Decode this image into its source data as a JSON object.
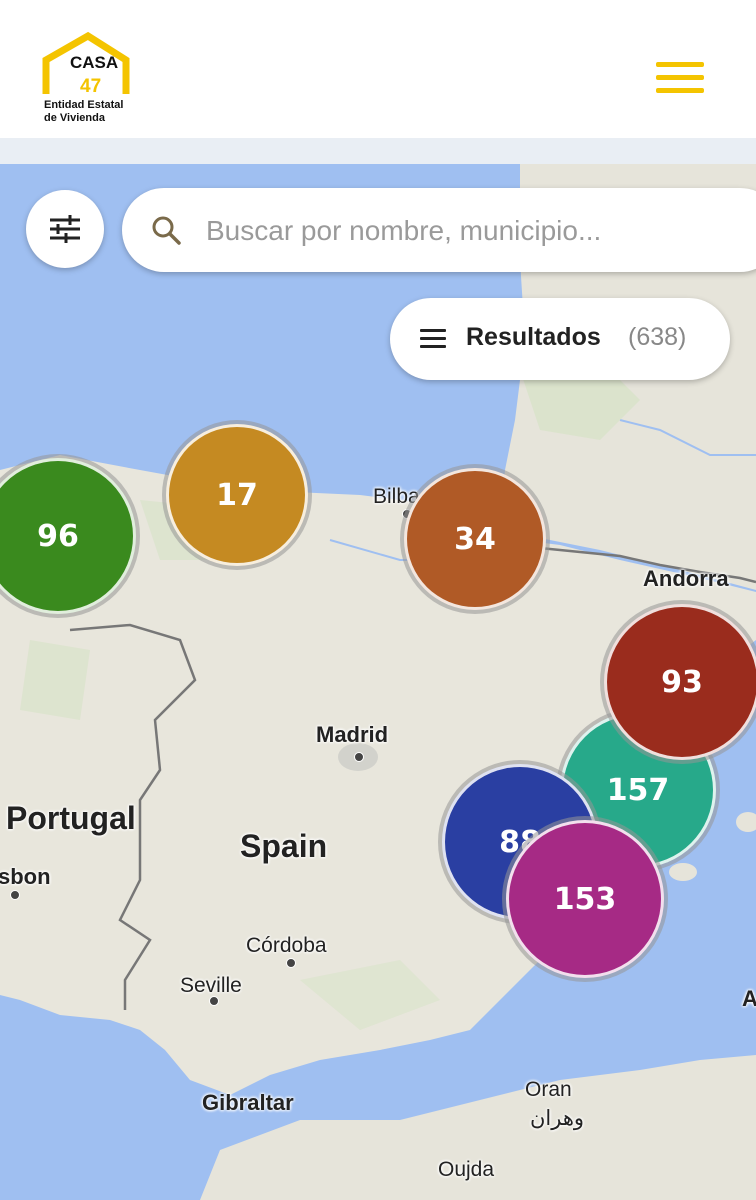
{
  "header": {
    "logo_text": "CASA",
    "logo_number": "47",
    "logo_line1": "Entidad Estatal",
    "logo_line2": "de Vivienda"
  },
  "search": {
    "placeholder": "Buscar por nombre, municipio..."
  },
  "results": {
    "label": "Resultados",
    "count": "(638)"
  },
  "places": {
    "portugal": "Portugal",
    "spain": "Spain",
    "madrid": "Madrid",
    "andorra": "Andorra",
    "bilbao": "Bilba",
    "lisbon": "sbon",
    "cordoba": "Córdoba",
    "seville": "Seville",
    "gibraltar": "Gibraltar",
    "oran": "Oran",
    "oran_ar": "وهران",
    "oujda": "Oujda",
    "edge_a": "A"
  },
  "clusters": [
    {
      "id": "c96",
      "label": "96",
      "color": "#3a8a1e"
    },
    {
      "id": "c17",
      "label": "17",
      "color": "#c58a22"
    },
    {
      "id": "c34",
      "label": "34",
      "color": "#b05a26"
    },
    {
      "id": "c93",
      "label": "93",
      "color": "#9a2c1d"
    },
    {
      "id": "c157",
      "label": "157",
      "color": "#27a98a"
    },
    {
      "id": "c88",
      "label": "88",
      "color": "#2a3fa2"
    },
    {
      "id": "c153",
      "label": "153",
      "color": "#a62a85"
    }
  ],
  "colors": {
    "accent": "#f4c400",
    "sea": "#9fbff1",
    "land": "#e8e6dc"
  }
}
